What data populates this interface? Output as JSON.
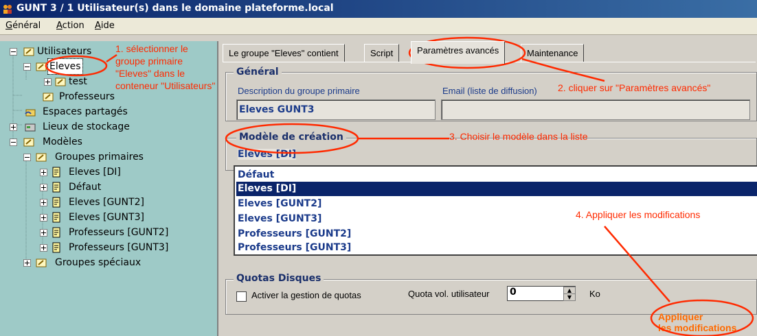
{
  "window": {
    "title": "GUNT 3 / 1 Utilisateur(s) dans le domaine plateforme.local"
  },
  "menu": [
    {
      "underline": "G",
      "rest": "énéral"
    },
    {
      "underline": "A",
      "rest": "ction"
    },
    {
      "underline": "A",
      "rest": "ide"
    }
  ],
  "tree": {
    "utilisateurs": "Utilisateurs",
    "eleves": "Eleves",
    "test": "test",
    "professeurs": "Professeurs",
    "espaces": "Espaces partagés",
    "lieux": "Lieux de stockage",
    "modeles": "Modèles",
    "groupes_primaires": "Groupes primaires",
    "gp_items": [
      "Eleves [DI]",
      "Défaut",
      "Eleves [GUNT2]",
      "Eleves [GUNT3]",
      "Professeurs [GUNT2]",
      "Professeurs [GUNT3]"
    ],
    "groupes_speciaux": "Groupes spéciaux"
  },
  "tabs": [
    "Le groupe \"Eleves\" contient",
    "Script",
    "Paramètres avancés",
    "Maintenance"
  ],
  "general": {
    "title": "Général",
    "desc_label": "Description du groupe primaire",
    "desc_value": "Eleves GUNT3",
    "email_label": "Email (liste de diffusion)",
    "email_value": ""
  },
  "modele": {
    "title": "Modèle de création",
    "selected": "Eleves [DI]",
    "options": [
      "Défaut",
      "Eleves [DI]",
      "Eleves [GUNT2]",
      "Eleves [GUNT3]",
      "Professeurs [GUNT2]",
      "Professeurs [GUNT3]"
    ]
  },
  "quotas": {
    "title": "Quotas Disques",
    "checkbox_label": "Activer la gestion de quotas",
    "quota_label": "Quota vol. utilisateur",
    "quota_value": "0",
    "unit": "Ko"
  },
  "apply": {
    "line1": "Appliquer",
    "line2": "les modifications"
  },
  "annotations": {
    "a1_line1": "1. sélectionner le",
    "a1_line2": "groupe primaire",
    "a1_line3": "\"Eleves\" dans le",
    "a1_line4": "conteneur \"Utilisateurs\"",
    "a2": "2. cliquer sur \"Paramètres avancés\"",
    "a3": "3. Choisir le modèle dans la liste",
    "a4": "4. Appliquer les modifications",
    "color": "#ff2a00"
  }
}
